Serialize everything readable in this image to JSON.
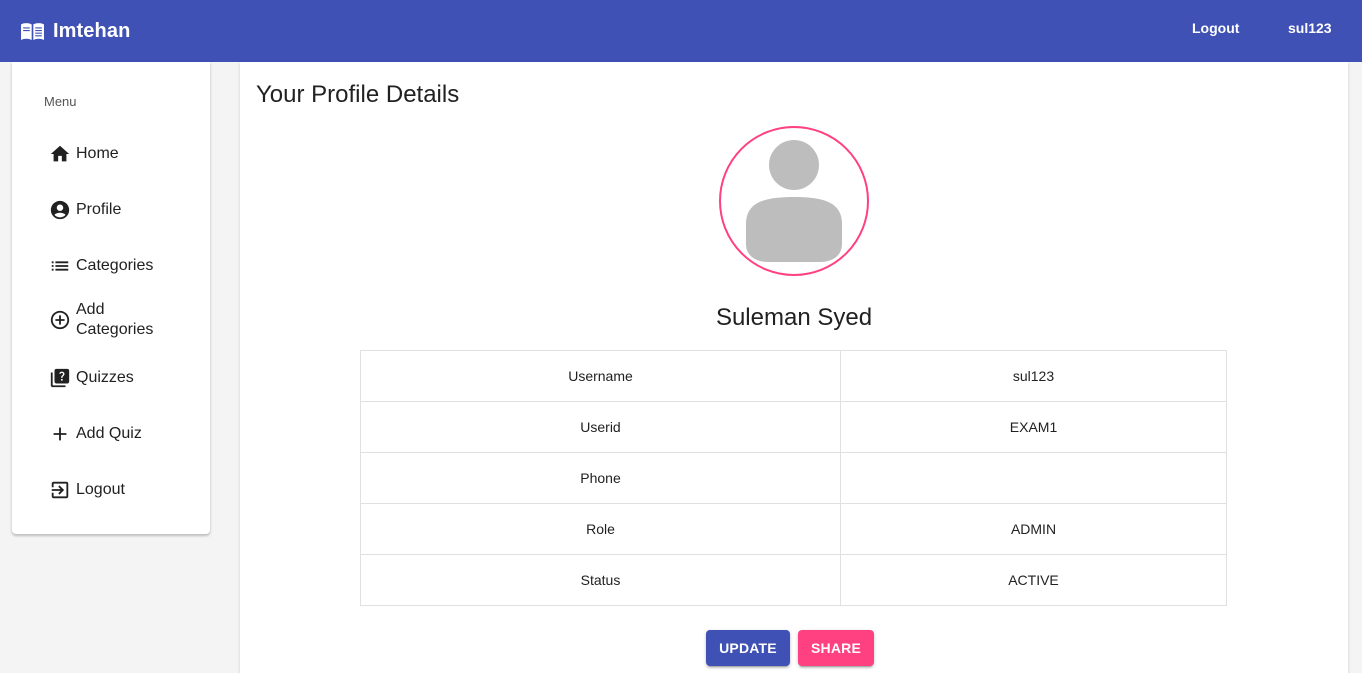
{
  "navbar": {
    "brand": "Imtehan",
    "brand_icon": "book-icon",
    "logout_label": "Logout",
    "username": "sul123",
    "background": "#3f51b5"
  },
  "sidebar": {
    "title": "Menu",
    "items": [
      {
        "label": "Home",
        "icon": "home-icon"
      },
      {
        "label": "Profile",
        "icon": "account-circle-icon"
      },
      {
        "label": "Categories",
        "icon": "list-icon"
      },
      {
        "label": "Add Categories",
        "icon": "add-circle-outline-icon"
      },
      {
        "label": "Quizzes",
        "icon": "quiz-icon"
      },
      {
        "label": "Add Quiz",
        "icon": "plus-icon"
      },
      {
        "label": "Logout",
        "icon": "logout-icon"
      }
    ]
  },
  "profile": {
    "title": "Your Profile Details",
    "avatar_icon": "user-avatar-icon",
    "avatar_border": "#ff4081",
    "name": "Suleman Syed",
    "rows": [
      {
        "label": "Username",
        "value": "sul123"
      },
      {
        "label": "Userid",
        "value": "EXAM1"
      },
      {
        "label": "Phone",
        "value": ""
      },
      {
        "label": "Role",
        "value": "ADMIN"
      },
      {
        "label": "Status",
        "value": "ACTIVE"
      }
    ],
    "update_label": "UPDATE",
    "share_label": "SHARE",
    "primary_color": "#3f51b5",
    "accent_color": "#ff4081"
  }
}
